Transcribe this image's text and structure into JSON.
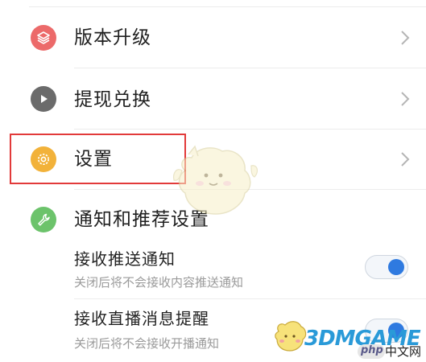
{
  "menu": {
    "items": [
      {
        "label": "版本升级",
        "icon": "layers-icon",
        "color": "#ec6a6a"
      },
      {
        "label": "提现兑换",
        "icon": "play-icon",
        "color": "#6b6b6b"
      },
      {
        "label": "设置",
        "icon": "gear-icon",
        "color": "#f2b23a"
      },
      {
        "label": "通知和推荐设置",
        "icon": "wrench-icon",
        "color": "#6cc36b"
      }
    ]
  },
  "notifications": {
    "push": {
      "title": "接收推送通知",
      "desc": "关闭后将不会接收内容推送通知",
      "enabled": true
    },
    "live": {
      "title": "接收直播消息提醒",
      "desc": "关闭后将不会接收开播通知",
      "enabled": true
    }
  },
  "watermark": {
    "brand": "3DMGAME",
    "php": "php",
    "site": "中文网"
  },
  "colors": {
    "accent": "#2f7ae0",
    "highlight": "#e23a3a"
  }
}
